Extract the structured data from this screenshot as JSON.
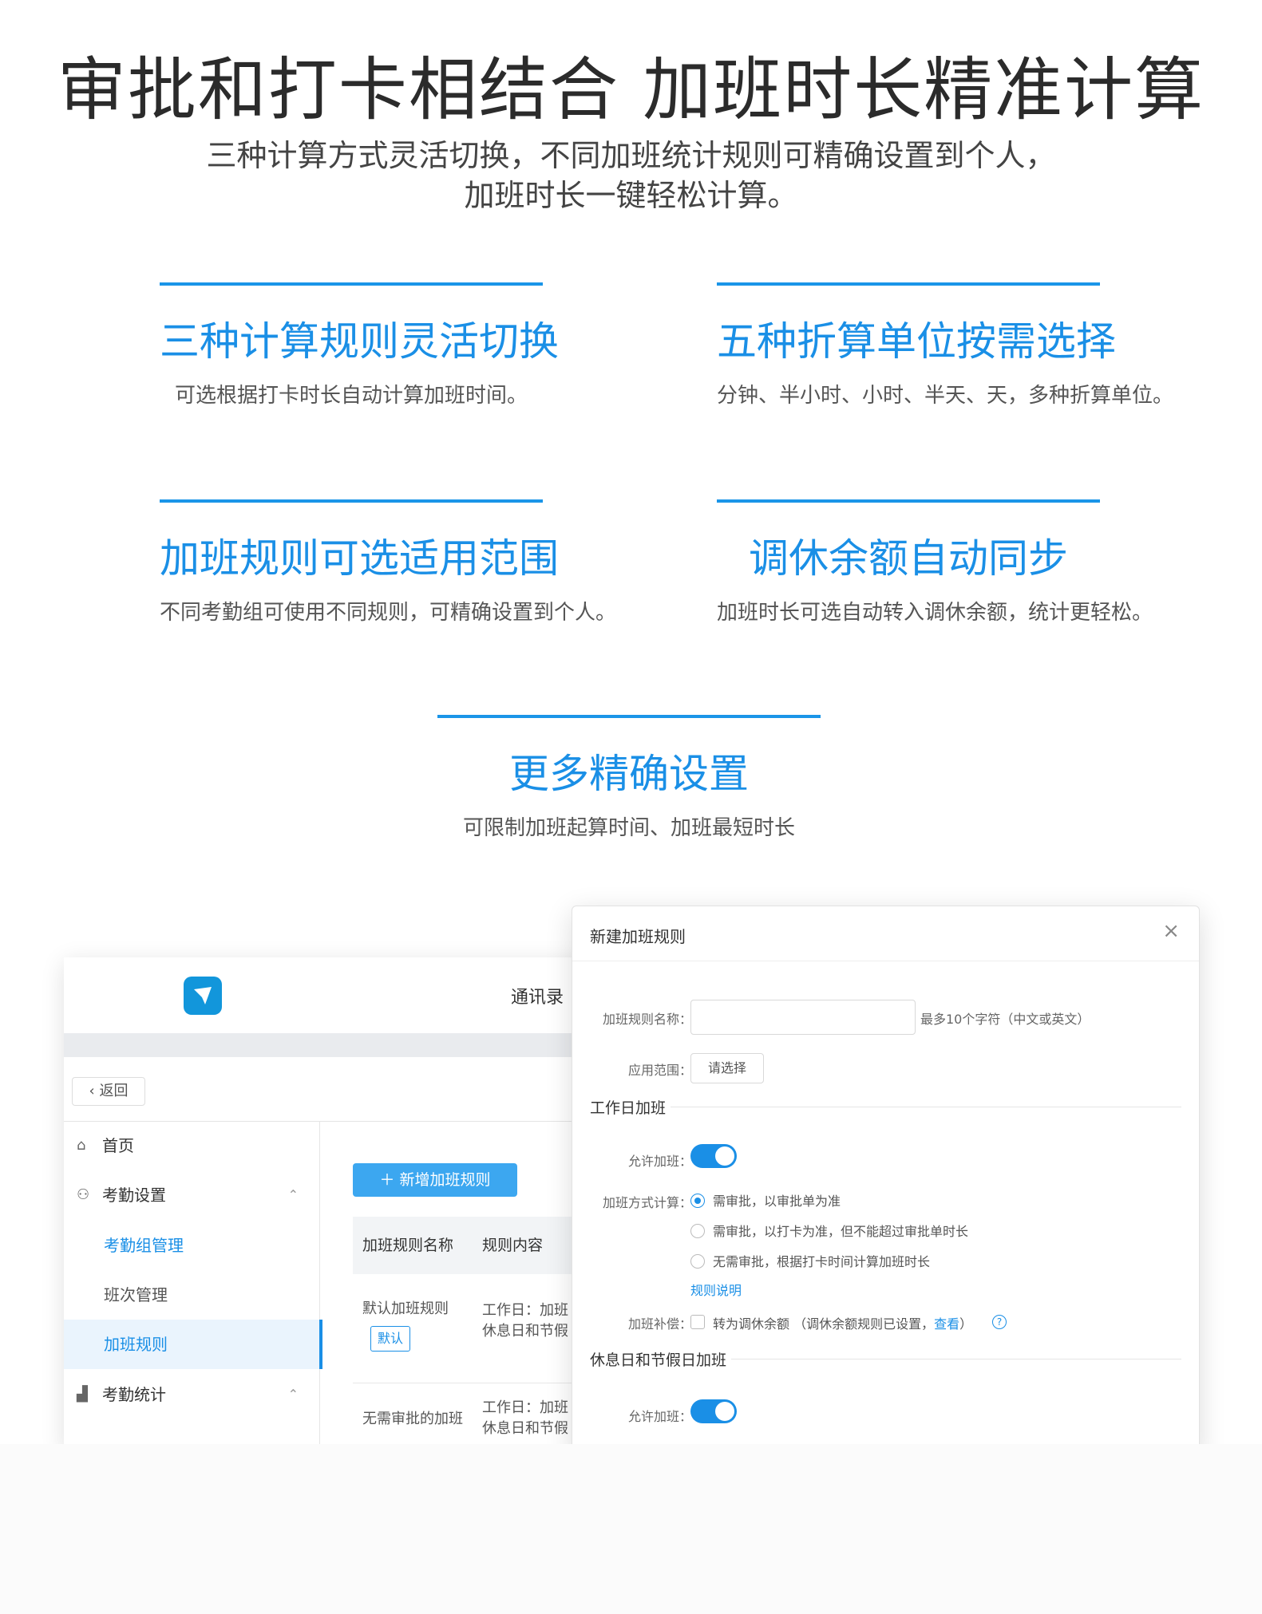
{
  "header": {
    "title": "审批和打卡相结合 加班时长精准计算",
    "subtitle_line1": "三种计算方式灵活切换，不同加班统计规则可精确设置到个人，",
    "subtitle_line2": "加班时长一键轻松计算。"
  },
  "features": [
    {
      "title": "三种计算规则灵活切换",
      "desc": "可选根据打卡时长自动计算加班时间。"
    },
    {
      "title": "五种折算单位按需选择",
      "desc": "分钟、半小时、小时、半天、天，多种折算单位。"
    },
    {
      "title": "加班规则可选适用范围",
      "desc": "不同考勤组可使用不同规则，可精确设置到个人。"
    },
    {
      "title": "调休余额自动同步",
      "desc": "加班时长可选自动转入调休余额，统计更轻松。"
    },
    {
      "title": "更多精确设置",
      "desc": "可限制加班起算时间、加班最短时长"
    }
  ],
  "colors": {
    "accent": "#1a8fe6",
    "divider": "#1a95e8"
  },
  "app": {
    "contacts_label": "通讯录",
    "back_label": "返回",
    "sidebar": {
      "home": "首页",
      "attendance_settings": "考勤设置",
      "group_mgmt": "考勤组管理",
      "shift_mgmt": "班次管理",
      "overtime_rules": "加班规则",
      "attendance_stats": "考勤统计"
    },
    "add_rule_button": "＋ 新增加班规则",
    "table": {
      "headers": [
        "加班规则名称",
        "规则内容"
      ],
      "rows": [
        {
          "name": "默认加班规则",
          "tag": "默认",
          "content_line1": "工作日：加班",
          "content_line2": "休息日和节假"
        },
        {
          "name": "无需审批的加班",
          "content_line1": "工作日：加班",
          "content_line2": "休息日和节假"
        }
      ]
    }
  },
  "modal": {
    "title": "新建加班规则",
    "close": "×",
    "name_label": "加班规则名称：",
    "name_placeholder": "",
    "name_hint": "最多10个字符（中文或英文）",
    "scope_label": "应用范围：",
    "scope_value": "请选择",
    "workday_section": "工作日加班",
    "allow_overtime_label": "允许加班：",
    "calc_label": "加班方式计算：",
    "options": [
      "需审批，以审批单为准",
      "需审批，以打卡为准，但不能超过审批单时长",
      "无需审批，根据打卡时间计算加班时长"
    ],
    "rule_desc_link": "规则说明",
    "comp_label": "加班补偿：",
    "comp_text": "转为调休余额 （调休余额规则已设置，",
    "comp_link": "查看",
    "comp_close": "）",
    "holiday_section": "休息日和节假日加班",
    "allow_overtime_label2": "允许加班："
  }
}
